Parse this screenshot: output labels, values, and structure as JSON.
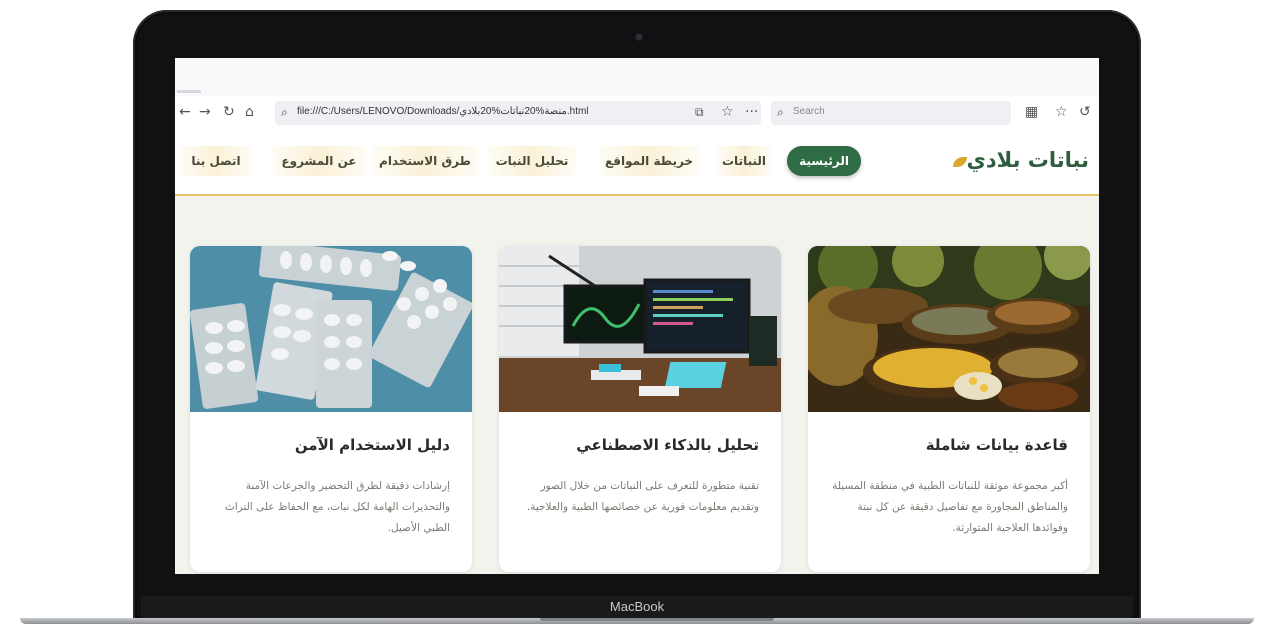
{
  "device": {
    "brand": "MacBook"
  },
  "browser": {
    "url": "file:///C:/Users/LENOVO/Downloads/منصة%20نباتات%20بلادي.html",
    "search_placeholder": "Search",
    "icons": [
      "back-arrow-icon",
      "forward-arrow-icon",
      "reload-icon",
      "home-icon",
      "search-icon",
      "translate-icon",
      "star-icon",
      "more-icon",
      "extensions-icon",
      "favorites-icon",
      "share-icon"
    ]
  },
  "site": {
    "logo_text": "نباتات بلادي",
    "nav": [
      {
        "label": "الرئيسية",
        "active": true
      },
      {
        "label": "النباتات"
      },
      {
        "label": "خريطة المواقع"
      },
      {
        "label": "تحليل النبات"
      },
      {
        "label": "طرق الاستخدام"
      },
      {
        "label": "عن المشروع"
      },
      {
        "label": "اتصل بنا"
      }
    ],
    "colors": {
      "primary": "#2f6b45",
      "accent": "#e7c26a",
      "nav_bg": "#faf1d6"
    },
    "cards": [
      {
        "title": "قاعدة بيانات شاملة",
        "text": "أكبر مجموعة موثقة للنباتات الطبية في منطقة المسيلة والمناطق المجاورة مع تفاصيل دقيقة عن كل نبتة وفوائدها العلاجية المتوارثة.",
        "image": "herbs-photo"
      },
      {
        "title": "تحليل بالذكاء الاصطناعي",
        "text": "تقنية متطورة للتعرف على النباتات من خلال الصور وتقديم معلومات فورية عن خصائصها الطبية والعلاجية.",
        "image": "computer-desk-photo"
      },
      {
        "title": "دليل الاستخدام الآمن",
        "text": "إرشادات دقيقة لطرق التحضير والجرعات الآمنة والتحذيرات الهامة لكل نبات، مع الحفاظ على التراث الطبي الأصيل.",
        "image": "pills-photo"
      }
    ]
  }
}
